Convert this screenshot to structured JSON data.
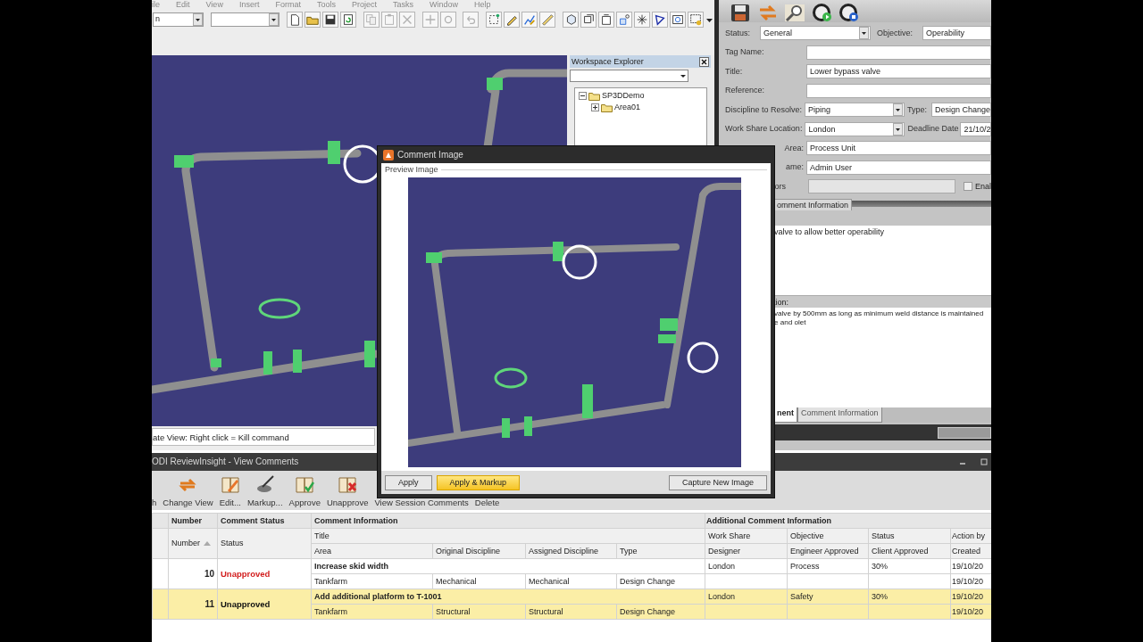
{
  "menu_bar": {
    "items": [
      "ile",
      "Edit",
      "View",
      "Insert",
      "Format",
      "Tools",
      "Project",
      "Tasks",
      "Window",
      "Help"
    ]
  },
  "toolbar": {
    "dropdown": {
      "value": "n"
    }
  },
  "viewport": {
    "status_text": "ate View: Right click = Kill command"
  },
  "workspace_explorer": {
    "title": "Workspace Explorer",
    "tree": [
      {
        "label": "SP3DDemo",
        "expanded": true,
        "children": [
          {
            "label": "Area01",
            "expanded": false
          }
        ]
      }
    ]
  },
  "comment_form": {
    "status": {
      "label": "Status:",
      "value": "General"
    },
    "objective": {
      "label": "Objective:",
      "value": "Operability"
    },
    "tag_name": {
      "label": "Tag Name:"
    },
    "title": {
      "label": "Title:",
      "value": "Lower bypass valve"
    },
    "reference": {
      "label": "Reference:"
    },
    "discipline": {
      "label": "Discipline to Resolve:",
      "value": "Piping"
    },
    "type": {
      "label": "Type:",
      "value": "Design Change"
    },
    "work_share": {
      "label": "Work Share Location:",
      "value": "London"
    },
    "deadline": {
      "label": "Deadline Date",
      "value": "21/10/2"
    },
    "area": {
      "label": "Area:",
      "value": "Process Unit"
    },
    "name": {
      "label": "ame:",
      "value": "Admin User"
    },
    "ors": {
      "label": "ors",
      "disabled": true
    },
    "enable": {
      "label": "Enal",
      "checked": false
    },
    "section_tab": {
      "label": "omment Information"
    },
    "description": {
      "text": "valve to allow better operability"
    },
    "resolution": {
      "label": "tion:",
      "lines": [
        "valve by 500mm as long as minimum weld distance is maintained",
        "e and olet"
      ]
    },
    "tabs": [
      {
        "label": "nent",
        "selected": true
      },
      {
        "label": "Comment Information",
        "selected": false
      }
    ]
  },
  "view_comments": {
    "title": "ODI ReviewInsight - View Comments",
    "toolbar": [
      {
        "label": "h",
        "kind": "text"
      },
      {
        "label": "Change View",
        "kind": "icon"
      },
      {
        "label": "Edit...",
        "kind": "icon"
      },
      {
        "label": "Markup...",
        "kind": "icon"
      },
      {
        "label": "Approve",
        "kind": "icon"
      },
      {
        "label": "Unapprove",
        "kind": "icon"
      },
      {
        "label": "View Session Comments",
        "kind": "text"
      },
      {
        "label": "Delete",
        "kind": "text"
      }
    ],
    "column_groups": [
      "Number",
      "Comment Status",
      "Comment Information",
      "Additional Comment Information"
    ],
    "columns_upper": [
      "Number",
      "Status",
      "Title",
      "Work Share",
      "Objective",
      "Status",
      "Action by"
    ],
    "columns_lower": [
      "Area",
      "Original Discipline",
      "Assigned Discipline",
      "Type",
      "Designer",
      "Engineer Approved",
      "Client Approved",
      "Created"
    ],
    "rows": [
      {
        "number": "10",
        "status": "Unapproved",
        "title": "Increase skid width",
        "work_share": "London",
        "objective": "Process",
        "status_pct": "30%",
        "action_by": "19/10/20",
        "area": "Tankfarm",
        "original_discipline": "Mechanical",
        "assigned_discipline": "Mechanical",
        "type": "Design Change",
        "created": "19/10/20",
        "selected": false
      },
      {
        "number": "11",
        "status": "Unapproved",
        "title": "Add additional platform to T-1001",
        "work_share": "London",
        "objective": "Safety",
        "status_pct": "30%",
        "action_by": "19/10/20",
        "area": "Tankfarm",
        "original_discipline": "Structural",
        "assigned_discipline": "Structural",
        "type": "Design Change",
        "created": "19/10/20",
        "selected": true
      }
    ]
  },
  "dialog": {
    "title": "Comment Image",
    "group": "Preview Image",
    "buttons": [
      {
        "label": "Apply",
        "hovered": false
      },
      {
        "label": "Apply & Markup",
        "hovered": true
      },
      {
        "label": "Capture New Image",
        "hovered": false
      }
    ]
  }
}
